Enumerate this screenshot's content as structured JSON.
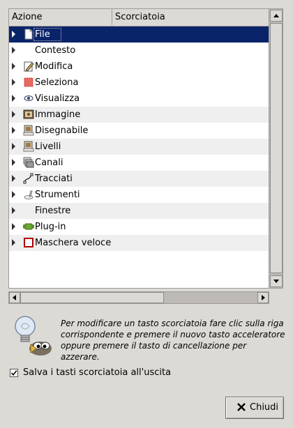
{
  "columns": {
    "action": "Azione",
    "shortcut": "Scorciatoia"
  },
  "rows": [
    {
      "label": "File",
      "icon": "file-icon",
      "selected": true
    },
    {
      "label": "Contesto",
      "icon": ""
    },
    {
      "label": "Modifica",
      "icon": "edit-icon"
    },
    {
      "label": "Seleziona",
      "icon": "selection-icon"
    },
    {
      "label": "Visualizza",
      "icon": "eye-icon"
    },
    {
      "label": "Immagine",
      "icon": "image-icon"
    },
    {
      "label": "Disegnabile",
      "icon": "drawable-icon"
    },
    {
      "label": "Livelli",
      "icon": "layers-icon"
    },
    {
      "label": "Canali",
      "icon": "channels-icon"
    },
    {
      "label": "Tracciati",
      "icon": "paths-icon"
    },
    {
      "label": "Strumenti",
      "icon": "tools-icon"
    },
    {
      "label": "Finestre",
      "icon": ""
    },
    {
      "label": "Plug-in",
      "icon": "plugin-icon"
    },
    {
      "label": "Maschera veloce",
      "icon": "quickmask-icon"
    }
  ],
  "hint": {
    "text": "Per modificare un tasto scorciatoia fare clic sulla riga corrispondente e premere il nuovo tasto acceleratore oppure premere il tasto di cancellazione per azzerare."
  },
  "save_on_exit": {
    "label": "Salva i tasti scorciatoia all'uscita",
    "checked": true
  },
  "close_button": {
    "label": "Chiudi"
  },
  "colors": {
    "selection": "#0a246a",
    "window_bg": "#dcdad5",
    "quickmask_red": "#b00000"
  }
}
